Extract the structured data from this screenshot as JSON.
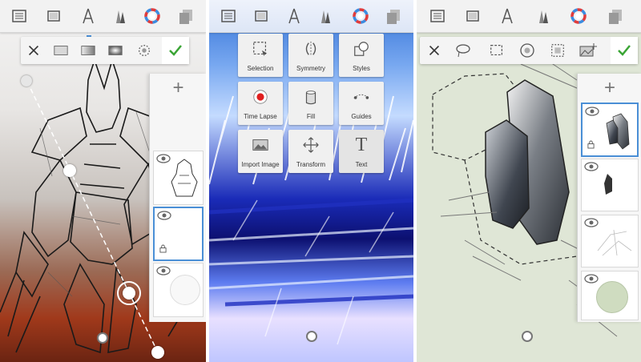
{
  "colors": {
    "accent": "#4a8fd6",
    "confirm": "#3aa535",
    "toolbar_bg": "#f2f2f2"
  },
  "toolbar_icons": [
    "layers-icon",
    "canvas-icon",
    "ruler-icon",
    "brushes-icon",
    "color-wheel-icon",
    "copy-layers-icon"
  ],
  "panel1": {
    "subbar_icons": [
      "close-icon",
      "solid-fill-icon",
      "linear-gradient-icon",
      "radial-gradient-icon",
      "settings-dial-icon",
      "checkmark-icon"
    ],
    "layers_add": "+",
    "layers": [
      "figure-sketch-layer",
      "fill-layer-selected",
      "empty-layer"
    ]
  },
  "panel2": {
    "tools": [
      {
        "label": "Selection",
        "icon": "selection-icon"
      },
      {
        "label": "Symmetry",
        "icon": "symmetry-icon"
      },
      {
        "label": "Styles",
        "icon": "styles-icon"
      },
      {
        "label": "Time Lapse",
        "icon": "record-icon"
      },
      {
        "label": "Fill",
        "icon": "fill-bucket-icon"
      },
      {
        "label": "Guides",
        "icon": "guides-icon"
      },
      {
        "label": "Import Image",
        "icon": "image-icon"
      },
      {
        "label": "Transform",
        "icon": "move-arrows-icon"
      },
      {
        "label": "Text",
        "icon": "text-icon"
      }
    ]
  },
  "panel3": {
    "subbar_icons": [
      "close-icon",
      "lasso-select-icon",
      "rect-select-icon",
      "ellipse-select-icon",
      "magic-select-icon",
      "import-image-icon",
      "checkmark-icon"
    ],
    "layers_add": "+",
    "layers": [
      "vehicle-shape-layer-selected",
      "small-shape-layer",
      "sketch-layer",
      "circle-layer"
    ]
  }
}
